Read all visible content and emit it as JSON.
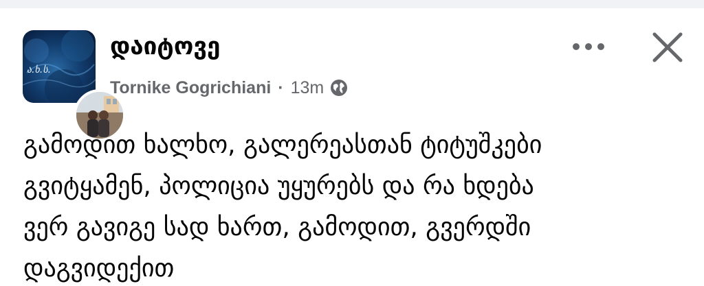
{
  "post": {
    "group_name": "დაიტოვე",
    "author_name": "Tornike Gogrichiani",
    "separator": "·",
    "time": "13m",
    "audience_icon": "globe-icon",
    "group_avatar_text": "ა.ხ.ს.",
    "more_icon": "more-horizontal-icon",
    "close_icon": "close-icon",
    "body_lines": [
      "გამოდით ხალხო, გალერეასთან ტიტუშკები",
      "გვიტყამენ, პოლიცია უყურებს და რა ხდება",
      "ვერ გავიგე სად ხართ, გამოდით, გვერდში",
      "დაგვიდექით"
    ]
  },
  "colors": {
    "primary_text": "#050505",
    "secondary_text": "#65676b",
    "background": "#ffffff",
    "divider": "#f0f2f5"
  }
}
